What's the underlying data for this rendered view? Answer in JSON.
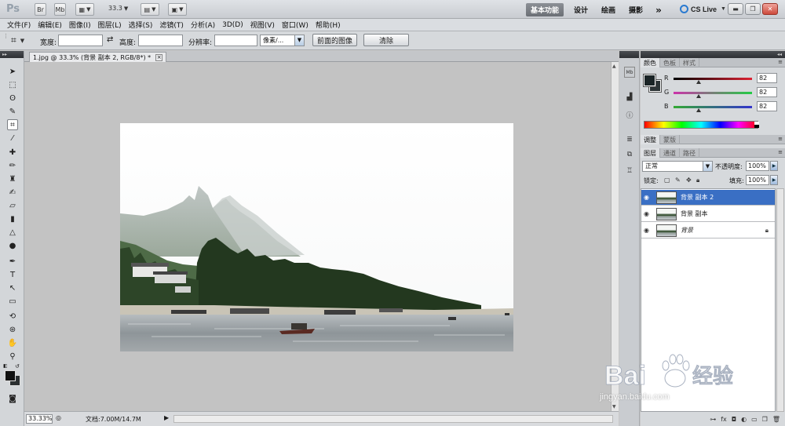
{
  "app": {
    "logo": "Ps",
    "bridge": "Br",
    "mini_bridge": "Mb",
    "zoom_level": "33.3",
    "workspaces": [
      "基本功能",
      "设计",
      "绘画",
      "摄影"
    ],
    "more": "»",
    "cs_live": "CS Live"
  },
  "menu": [
    "文件(F)",
    "编辑(E)",
    "图像(I)",
    "图层(L)",
    "选择(S)",
    "滤镜(T)",
    "分析(A)",
    "3D(D)",
    "视图(V)",
    "窗口(W)",
    "帮助(H)"
  ],
  "options": {
    "width_label": "宽度:",
    "width_value": "",
    "height_label": "高度:",
    "height_value": "",
    "resolution_label": "分辨率:",
    "resolution_value": "",
    "unit": "像素/...",
    "front_image_button": "前面的图像",
    "clear_button": "清除"
  },
  "document": {
    "tab_title": "1.jpg @ 33.3% (背景 副本 2, RGB/8*) *",
    "status_zoom": "33.33%",
    "status_doc": "文档:7.00M/14.7M"
  },
  "color_panel": {
    "tabs": [
      "颜色",
      "色板",
      "样式"
    ],
    "channels": [
      {
        "label": "R",
        "value": "82",
        "fraction": 0.32
      },
      {
        "label": "G",
        "value": "82",
        "fraction": 0.32
      },
      {
        "label": "B",
        "value": "82",
        "fraction": 0.32
      }
    ],
    "fg_color": "#1a2426",
    "bg_color": "#2c3436"
  },
  "adjust_panel": {
    "tabs": [
      "调整",
      "蒙版"
    ]
  },
  "layers_panel": {
    "tabs": [
      "图层",
      "通道",
      "路径"
    ],
    "blend_mode": "正常",
    "opacity_label": "不透明度:",
    "opacity_value": "100%",
    "lock_label": "锁定:",
    "fill_label": "填充:",
    "fill_value": "100%",
    "layers": [
      {
        "name": "背景 副本 2",
        "selected": true,
        "locked": false,
        "italic": false
      },
      {
        "name": "背景 副本",
        "selected": false,
        "locked": false,
        "italic": false
      },
      {
        "name": "背景",
        "selected": false,
        "locked": true,
        "italic": true
      }
    ]
  },
  "watermark": {
    "brand": "Bai",
    "brand2": "经验",
    "url": "jingyan.baidu.com"
  }
}
